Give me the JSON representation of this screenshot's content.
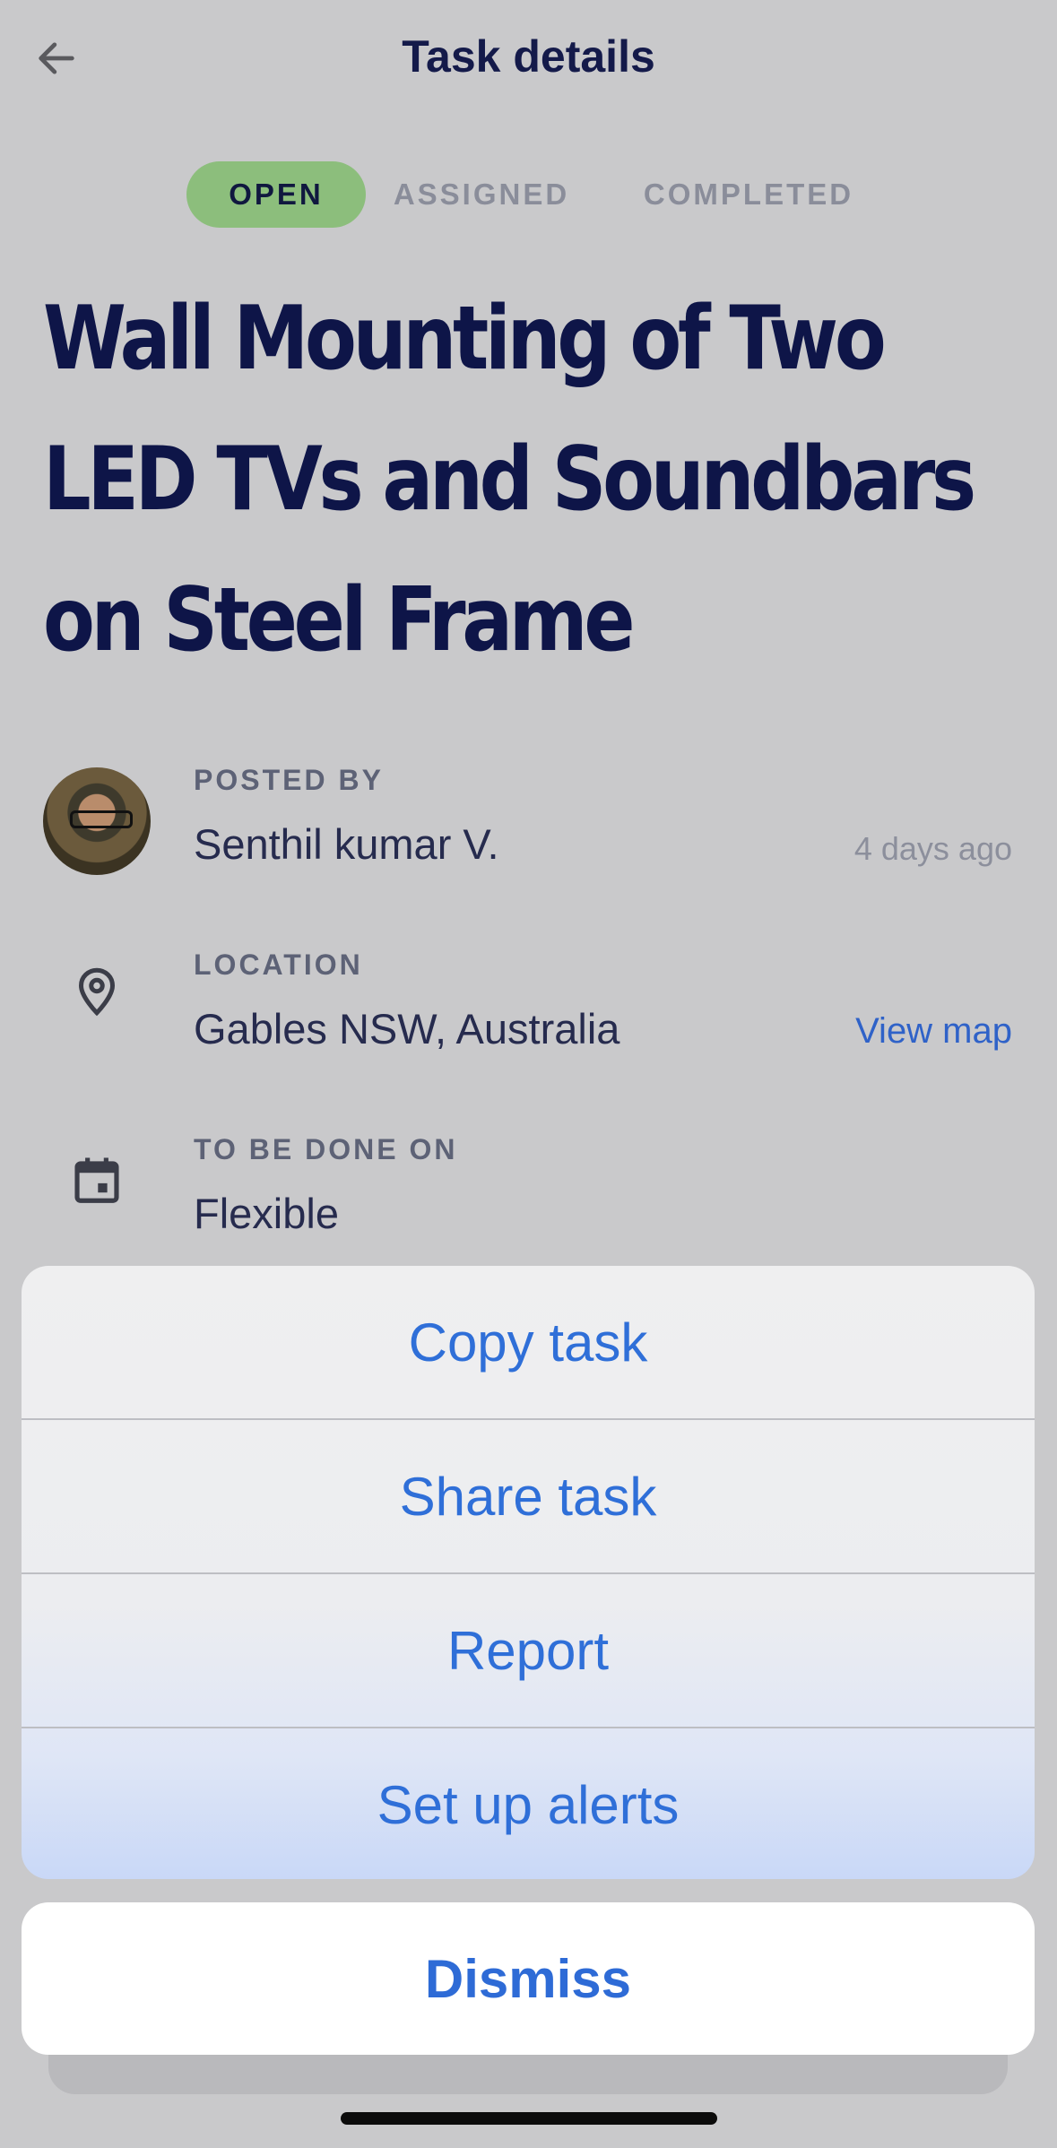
{
  "header": {
    "title": "Task details",
    "back_icon": "arrow-left-icon"
  },
  "status_tabs": [
    {
      "label": "OPEN",
      "active": true
    },
    {
      "label": "ASSIGNED",
      "active": false
    },
    {
      "label": "COMPLETED",
      "active": false
    }
  ],
  "task": {
    "title": "Wall Mounting of Two LED TVs and Soundbars on Steel Frame"
  },
  "posted_by": {
    "label": "POSTED BY",
    "name": "Senthil kumar V.",
    "time": "4 days ago"
  },
  "location": {
    "label": "LOCATION",
    "value": "Gables NSW, Australia",
    "link": "View map",
    "icon": "location-pin-icon"
  },
  "schedule": {
    "label": "TO BE DONE ON",
    "value": "Flexible",
    "icon": "calendar-icon"
  },
  "action_sheet": {
    "items": [
      "Copy task",
      "Share task",
      "Report",
      "Set up alerts"
    ],
    "dismiss": "Dismiss"
  },
  "colors": {
    "accent": "#2f6fd8",
    "open_chip": "#8cbe7c",
    "title": "#0e1548"
  }
}
